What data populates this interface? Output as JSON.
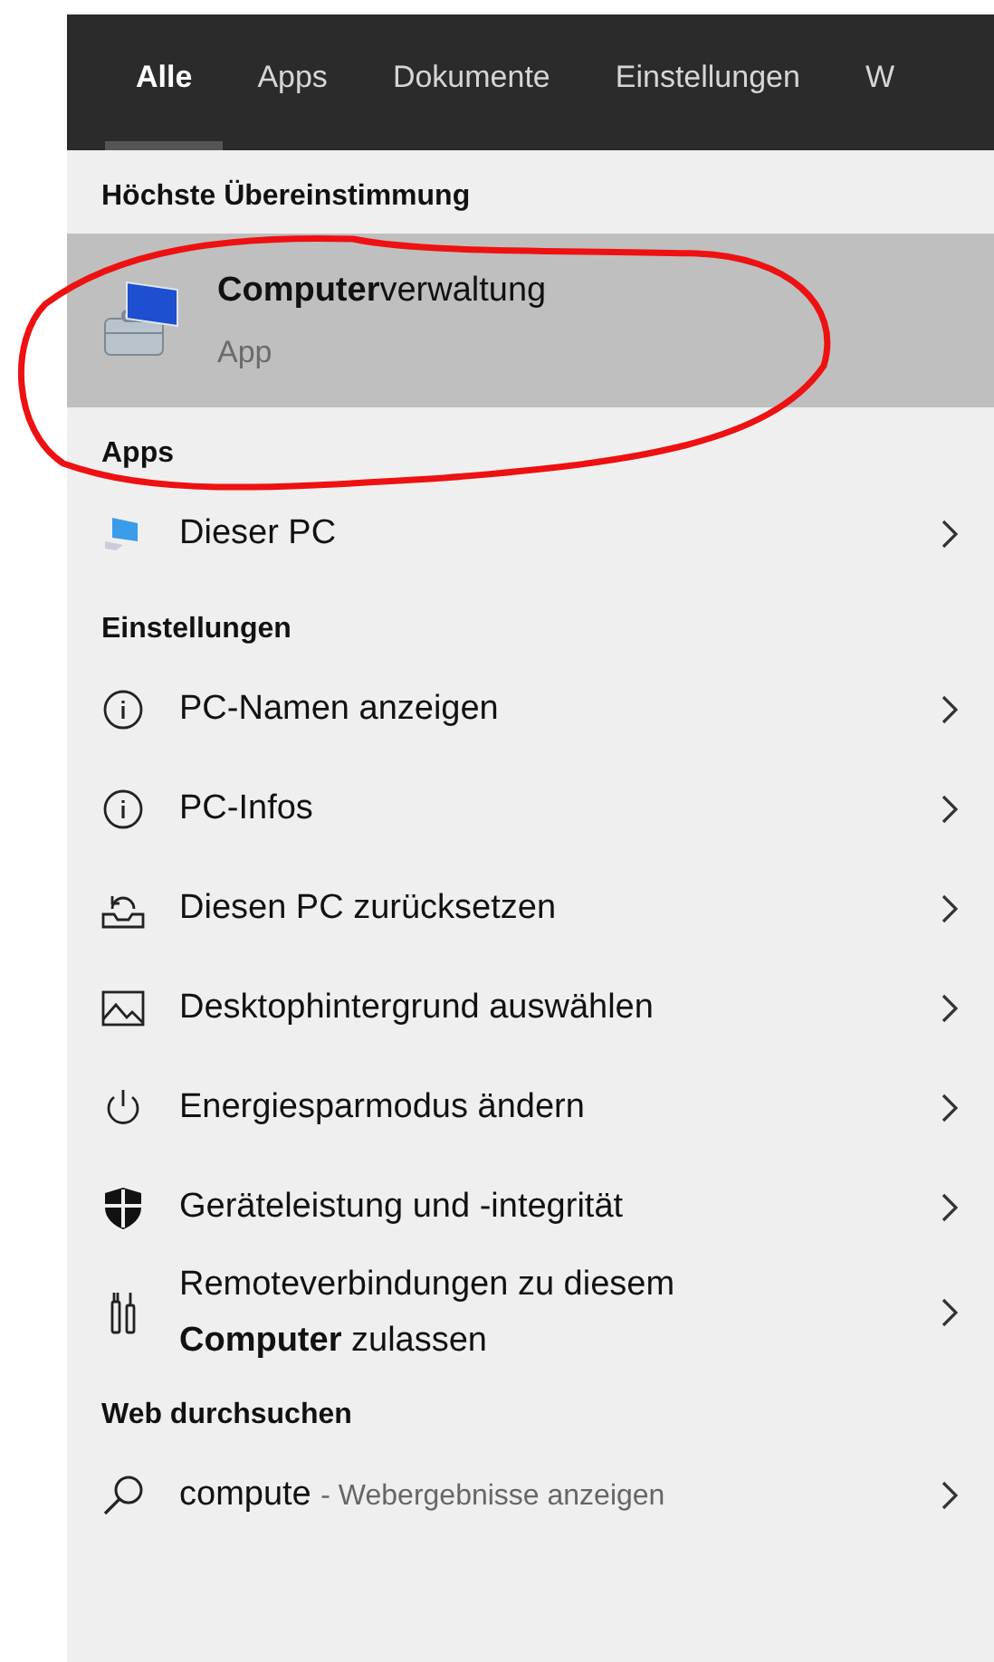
{
  "tabs": [
    {
      "label": "Alle",
      "selected": true
    },
    {
      "label": "Apps",
      "selected": false
    },
    {
      "label": "Dokumente",
      "selected": false
    },
    {
      "label": "Einstellungen",
      "selected": false
    },
    {
      "label": "W",
      "selected": false
    }
  ],
  "best_match": {
    "heading": "Höchste Übereinstimmung",
    "title": "**Computer**verwaltung",
    "subtitle": "App",
    "selected": true
  },
  "apps": {
    "heading": "Apps",
    "items": [
      {
        "label": "Dieser PC"
      }
    ]
  },
  "settings": {
    "heading": "Einstellungen",
    "items": [
      {
        "label": "PC-Namen anzeigen"
      },
      {
        "label": "PC-Infos"
      },
      {
        "label": "Diesen PC zurücksetzen"
      },
      {
        "label": "Desktophintergrund auswählen"
      },
      {
        "label": "Energiesparmodus ändern"
      },
      {
        "label": "Geräteleistung und -integrität"
      },
      {
        "label": "Remoteverbindungen zu diesem **Computer** zulassen"
      }
    ]
  },
  "web": {
    "heading": "Web durchsuchen",
    "query": "compute",
    "hint": "- Webergebnisse anzeigen"
  }
}
